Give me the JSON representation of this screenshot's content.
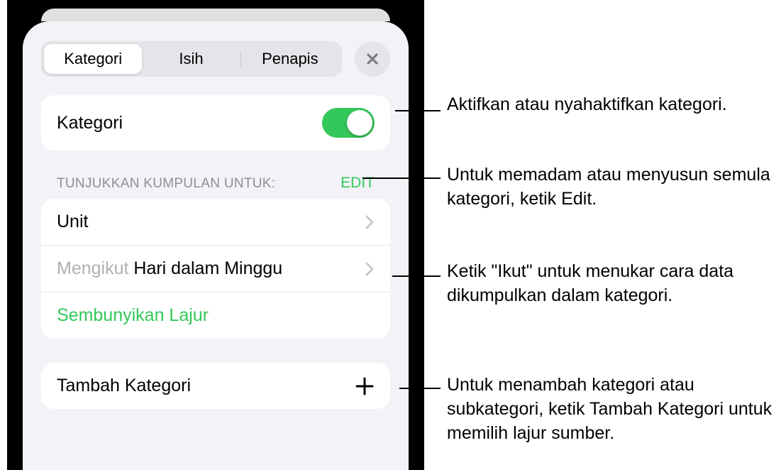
{
  "tabs": {
    "kategori": "Kategori",
    "isih": "Isih",
    "penapis": "Penapis"
  },
  "toggle_row": {
    "label": "Kategori"
  },
  "section_header": {
    "label": "TUNJUKKAN KUMPULAN UNTUK:",
    "edit": "EDIT"
  },
  "list": {
    "unit": "Unit",
    "by_prefix": "Mengikut ",
    "by_value": "Hari dalam Minggu",
    "hide_column": "Sembunyikan Lajur"
  },
  "add_row": {
    "label": "Tambah Kategori"
  },
  "colors": {
    "accent": "#34c759"
  },
  "callouts": {
    "c1": "Aktifkan atau nyahaktifkan kategori.",
    "c2": "Untuk memadam atau menyusun semula kategori, ketik Edit.",
    "c3": "Ketik \"Ikut\" untuk menukar cara data dikumpulkan dalam kategori.",
    "c4": "Untuk menambah kategori atau subkategori, ketik Tambah Kategori untuk memilih lajur sumber."
  }
}
